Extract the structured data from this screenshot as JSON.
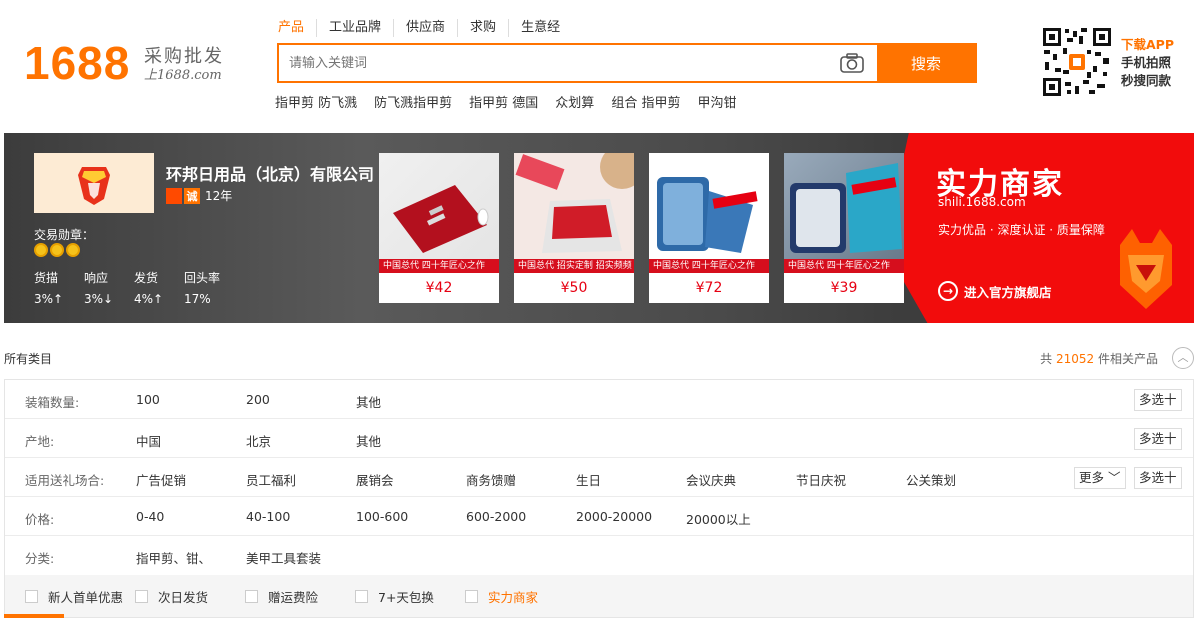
{
  "header": {
    "logo_number": "1688",
    "logo_tag1": "采购批发",
    "logo_tag2": "上1688.com",
    "search_tabs": [
      "产品",
      "工业品牌",
      "供应商",
      "求购",
      "生意经"
    ],
    "search_placeholder": "请输入关键词",
    "search_button": "搜索",
    "hot_words": [
      "指甲剪 防飞溅",
      "防飞溅指甲剪",
      "指甲剪 德国",
      "众划算",
      "组合 指甲剪",
      "甲沟钳"
    ],
    "app_download": "下载APP",
    "app_line2": "手机拍照",
    "app_line3": "秒搜同款"
  },
  "banner": {
    "company_name": "环邦日用品（北京）有限公司",
    "cheng_badge": "诚",
    "years": "12年",
    "trade_medal_label": "交易勋章：",
    "stats": [
      {
        "label": "货描",
        "value": "3%↑"
      },
      {
        "label": "响应",
        "value": "3%↓"
      },
      {
        "label": "发货",
        "value": "4%↑"
      },
      {
        "label": "回头率",
        "value": "17%"
      }
    ],
    "products": [
      {
        "price": "¥42",
        "tag": "中国总代  四十年匠心之作"
      },
      {
        "price": "¥50",
        "tag": "中国总代  招实定制 招实频频"
      },
      {
        "price": "¥72",
        "tag": "中国总代  四十年匠心之作"
      },
      {
        "price": "¥39",
        "tag": "中国总代  四十年匠心之作"
      }
    ],
    "shili_title": "实力商家",
    "shili_url": "shili.1688.com",
    "shili_slogan": "实力优品 · 深度认证 · 质量保障",
    "shili_enter": "进入官方旗舰店",
    "colors": {
      "accent": "#ff7300",
      "red": "#f20c0c"
    }
  },
  "category": {
    "all": "所有类目",
    "count_prefix": "共",
    "count": "21052",
    "count_suffix": "件相关产品"
  },
  "filters": [
    {
      "label": "装箱数量:",
      "options": [
        "100",
        "200",
        "其他"
      ],
      "more": null,
      "multi": "多选"
    },
    {
      "label": "产地:",
      "options": [
        "中国",
        "北京",
        "其他"
      ],
      "more": null,
      "multi": "多选"
    },
    {
      "label": "适用送礼场合:",
      "options": [
        "广告促销",
        "员工福利",
        "展销会",
        "商务馈赠",
        "生日",
        "会议庆典",
        "节日庆祝",
        "公关策划"
      ],
      "more": "更多",
      "multi": "多选"
    },
    {
      "label": "价格:",
      "options": [
        "0-40",
        "40-100",
        "100-600",
        "600-2000",
        "2000-20000",
        "20000以上"
      ],
      "more": null,
      "multi": null
    },
    {
      "label": "分类:",
      "options": [
        "指甲剪、钳、",
        "美甲工具套装"
      ],
      "more": null,
      "multi": null
    }
  ],
  "checks": [
    "新人首单优惠",
    "次日发货",
    "赠运费险",
    "7+天包换",
    "实力商家"
  ]
}
